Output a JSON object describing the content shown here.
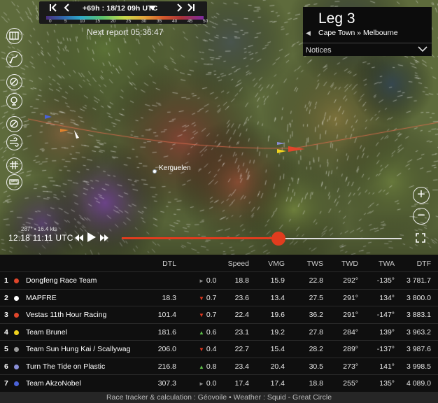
{
  "colors": {
    "accent": "#e03c1e",
    "up": "#5fc24a",
    "down": "#e0371e",
    "flat": "#8a8a8a"
  },
  "timebar": {
    "first_icon": "skip-back-icon",
    "prev_icon": "chevron-left-icon",
    "label": "+69h : 18/12 09h UTC",
    "dropdown_icon": "caret-down-icon",
    "next_icon": "chevron-right-icon",
    "last_icon": "skip-forward-icon",
    "scale_ticks": [
      "0",
      "5",
      "10",
      "15",
      "20",
      "25",
      "30",
      "35",
      "40",
      "45",
      "50"
    ]
  },
  "next_report": "Next report 05:36:47",
  "leg": {
    "title": "Leg 3",
    "route": "Cape Town » Melbourne",
    "notices": "Notices"
  },
  "tools": [
    "map-layers-icon",
    "route-icon",
    "compass-icon",
    "buoy-icon",
    "heading-icon",
    "wind-icon",
    "grid-icon",
    "ruler-icon"
  ],
  "map": {
    "place_label": "Kerguelen"
  },
  "playback": {
    "wind": "287° • 16.4 kts",
    "time": "12.18 11:11 UTC",
    "progress": 0.56
  },
  "table": {
    "headers": [
      "DTL",
      "Speed",
      "VMG",
      "TWS",
      "TWD",
      "TWA",
      "DTF"
    ],
    "rows": [
      {
        "rank": "1",
        "color": "#e0462b",
        "team": "Dongfeng Race Team",
        "dtl": "",
        "trend": "flat",
        "delta": "0.0",
        "speed": "18.8",
        "vmg": "15.9",
        "tws": "22.8",
        "twd": "292°",
        "twa": "-135°",
        "dtf": "3 781.7"
      },
      {
        "rank": "2",
        "color": "#ffffff",
        "team": "MAPFRE",
        "dtl": "18.3",
        "trend": "down",
        "delta": "0.7",
        "speed": "23.6",
        "vmg": "13.4",
        "tws": "27.5",
        "twd": "291°",
        "twa": "134°",
        "dtf": "3 800.0"
      },
      {
        "rank": "3",
        "color": "#e0462b",
        "team": "Vestas 11th Hour Racing",
        "dtl": "101.4",
        "trend": "down",
        "delta": "0.7",
        "speed": "22.4",
        "vmg": "19.6",
        "tws": "36.2",
        "twd": "291°",
        "twa": "-147°",
        "dtf": "3 883.1"
      },
      {
        "rank": "4",
        "color": "#f0d21e",
        "team": "Team Brunel",
        "dtl": "181.6",
        "trend": "up",
        "delta": "0.6",
        "speed": "23.1",
        "vmg": "19.2",
        "tws": "27.8",
        "twd": "284°",
        "twa": "139°",
        "dtf": "3 963.2"
      },
      {
        "rank": "5",
        "color": "#9a9a9a",
        "team": "Team Sun Hung Kai / Scallywag",
        "dtl": "206.0",
        "trend": "down",
        "delta": "0.4",
        "speed": "22.7",
        "vmg": "15.4",
        "tws": "28.2",
        "twd": "289°",
        "twa": "-137°",
        "dtf": "3 987.6"
      },
      {
        "rank": "6",
        "color": "#8a8fd8",
        "team": "Turn The Tide on Plastic",
        "dtl": "216.8",
        "trend": "up",
        "delta": "0.8",
        "speed": "23.4",
        "vmg": "20.4",
        "tws": "30.5",
        "twd": "273°",
        "twa": "141°",
        "dtf": "3 998.5"
      },
      {
        "rank": "7",
        "color": "#4a62d8",
        "team": "Team AkzoNobel",
        "dtl": "307.3",
        "trend": "flat",
        "delta": "0.0",
        "speed": "17.4",
        "vmg": "17.4",
        "tws": "18.8",
        "twd": "255°",
        "twa": "135°",
        "dtf": "4 089.0"
      }
    ]
  },
  "footer": "Race tracker & calculation : Géovoile • Weather : Squid - Great Circle"
}
